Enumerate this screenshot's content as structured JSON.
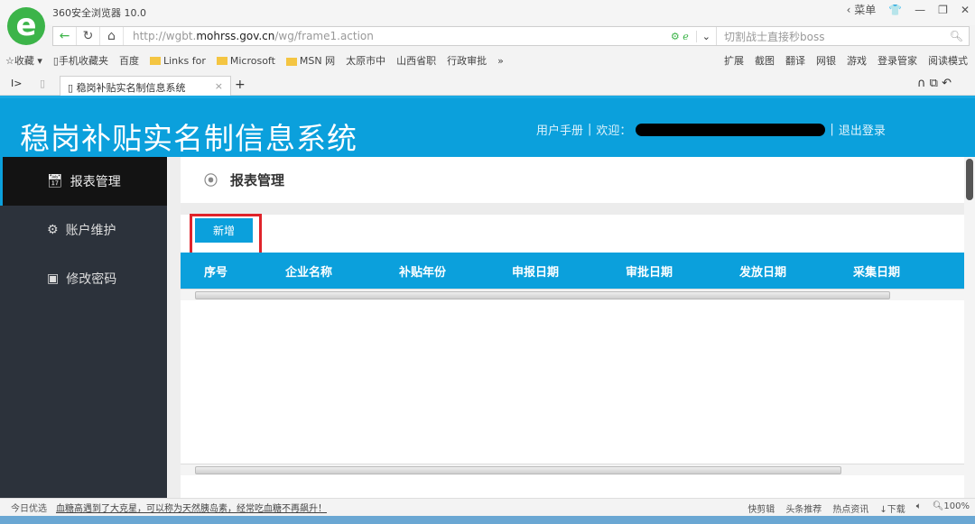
{
  "browser": {
    "title": "360安全浏览器 10.0",
    "menu": "菜单",
    "url_prefix": "http://wgbt.",
    "url_domain": "mohrss.gov.cn",
    "url_path": "/wg/frame1.action",
    "search_placeholder": "切割战士直接秒boss",
    "bookmarks": [
      "收藏",
      "手机收藏夹",
      "百度",
      "Links for",
      "Microsoft",
      "MSN 网",
      "太原市中",
      "山西省职",
      "行政审批",
      "»"
    ],
    "tools": [
      "扩展",
      "截图",
      "翻译",
      "网银",
      "游戏",
      "登录管家",
      "阅读模式"
    ],
    "tab_title": "稳岗补贴实名制信息系统"
  },
  "header": {
    "title": "稳岗补贴实名制信息系统",
    "manual": "用户手册",
    "welcome": "欢迎：",
    "logout": "退出登录",
    "sep": "|"
  },
  "sidebar": {
    "items": [
      {
        "label": "报表管理"
      },
      {
        "label": "账户维护"
      },
      {
        "label": "修改密码"
      }
    ]
  },
  "main": {
    "breadcrumb": "报表管理",
    "add_button": "新增",
    "columns": [
      "序号",
      "企业名称",
      "补贴年份",
      "申报日期",
      "审批日期",
      "发放日期",
      "采集日期"
    ]
  },
  "statusbar": {
    "today": "今日优选",
    "news": "血糖高遇到了大克星，可以称为天然胰岛素，经常吃血糖不再飙升！",
    "items": [
      "快剪辑",
      "头条推荐",
      "热点资讯",
      "下载"
    ],
    "zoom": "100%"
  }
}
